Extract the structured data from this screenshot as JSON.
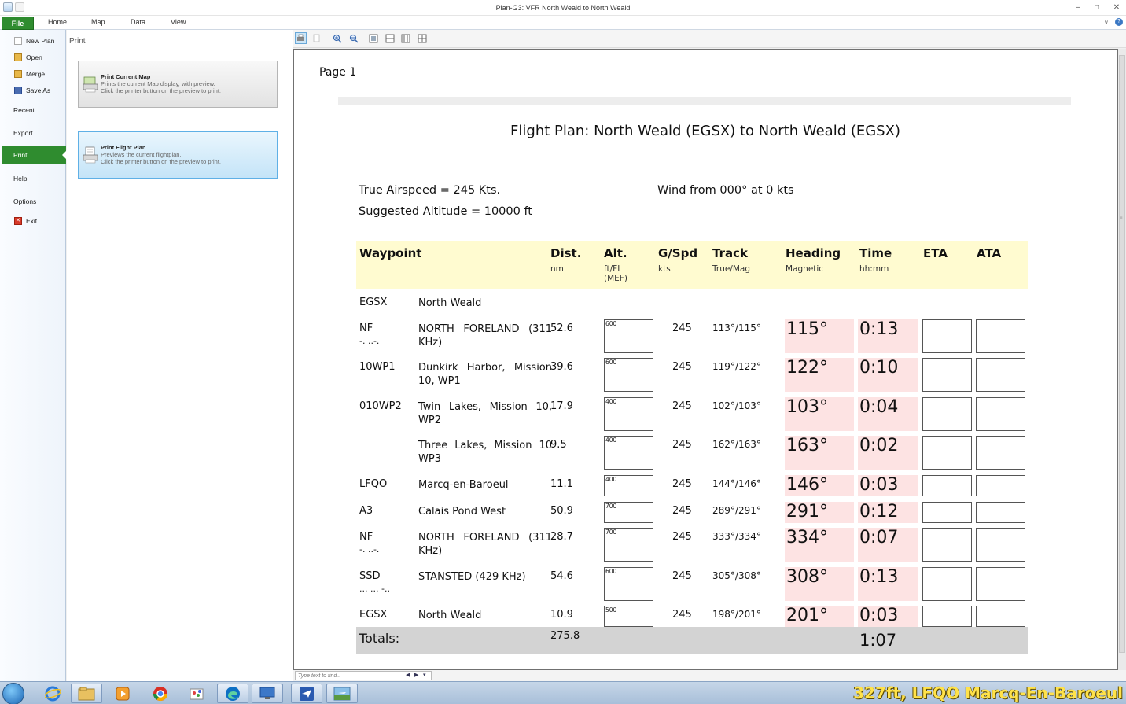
{
  "window": {
    "title": "Plan-G3: VFR North Weald to North Weald"
  },
  "ribbon": {
    "tabs": [
      "File",
      "Home",
      "Map",
      "Data",
      "View"
    ]
  },
  "leftnav": {
    "items": [
      {
        "label": "New Plan",
        "icon": "new-plan-icon"
      },
      {
        "label": "Open",
        "icon": "folder-open-icon"
      },
      {
        "label": "Merge",
        "icon": "merge-icon"
      },
      {
        "label": "Save As",
        "icon": "save-icon"
      },
      {
        "label": "Recent"
      },
      {
        "label": "Export"
      },
      {
        "label": "Print",
        "active": true
      },
      {
        "label": "Help"
      },
      {
        "label": "Options"
      },
      {
        "label": "Exit",
        "icon": "exit-icon"
      }
    ]
  },
  "print_panel": {
    "title": "Print",
    "options": [
      {
        "title": "Print Current Map",
        "line1": "Prints the current Map display, with preview.",
        "line2": "Click the printer button on the preview to print.",
        "selected": false
      },
      {
        "title": "Print Flight Plan",
        "line1": "Previews the current flightplan.",
        "line2": "Click the printer button on the preview to print.",
        "selected": true
      }
    ]
  },
  "preview": {
    "page_label": "Page 1",
    "title": "Flight Plan: North Weald (EGSX) to North Weald (EGSX)",
    "true_airspeed": "True Airspeed = 245 Kts.",
    "wind": "Wind from 000° at 0 kts",
    "suggested_altitude": "Suggested Altitude = 10000 ft",
    "headers": {
      "waypoint": "Waypoint",
      "dist": "Dist.",
      "dist_sub": "nm",
      "alt": "Alt.",
      "alt_sub1": "ft/FL",
      "alt_sub2": "(MEF)",
      "gspd": "G/Spd",
      "gspd_sub": "kts",
      "track": "Track",
      "track_sub": "True/Mag",
      "heading": "Heading",
      "heading_sub": "Magnetic",
      "time": "Time",
      "time_sub": "hh:mm",
      "eta": "ETA",
      "ata": "ATA"
    },
    "rows": [
      {
        "id": "EGSX",
        "morse": "",
        "name": "North Weald",
        "dist": "",
        "alt": "",
        "gs": "",
        "track": "",
        "heading": "",
        "time": ""
      },
      {
        "id": "NF",
        "morse": "-. ..-.",
        "name": "NORTH FORELAND (311 KHz)",
        "dist": "52.6",
        "alt": "600",
        "gs": "245",
        "track": "113°/115°",
        "heading": "115°",
        "time": "0:13"
      },
      {
        "id": "10WP1",
        "morse": "",
        "name": "Dunkirk Harbor, Mission 10, WP1",
        "dist": "39.6",
        "alt": "600",
        "gs": "245",
        "track": "119°/122°",
        "heading": "122°",
        "time": "0:10"
      },
      {
        "id": "010WP2",
        "morse": "",
        "name": "Twin Lakes, Mission 10, WP2",
        "dist": "17.9",
        "alt": "400",
        "gs": "245",
        "track": "102°/103°",
        "heading": "103°",
        "time": "0:04"
      },
      {
        "id": "",
        "morse": "",
        "name": "Three Lakes, Mission 10 WP3",
        "dist": "9.5",
        "alt": "400",
        "gs": "245",
        "track": "162°/163°",
        "heading": "163°",
        "time": "0:02"
      },
      {
        "id": "LFQO",
        "morse": "",
        "name": "Marcq-en-Baroeul",
        "dist": "11.1",
        "alt": "400",
        "gs": "245",
        "track": "144°/146°",
        "heading": "146°",
        "time": "0:03"
      },
      {
        "id": "A3",
        "morse": "",
        "name": "Calais Pond West",
        "dist": "50.9",
        "alt": "700",
        "gs": "245",
        "track": "289°/291°",
        "heading": "291°",
        "time": "0:12"
      },
      {
        "id": "NF",
        "morse": "-. ..-.",
        "name": "NORTH FORELAND (311 KHz)",
        "dist": "28.7",
        "alt": "700",
        "gs": "245",
        "track": "333°/334°",
        "heading": "334°",
        "time": "0:07"
      },
      {
        "id": "SSD",
        "morse": "... ... -..",
        "name": "STANSTED (429 KHz)",
        "dist": "54.6",
        "alt": "600",
        "gs": "245",
        "track": "305°/308°",
        "heading": "308°",
        "time": "0:13"
      },
      {
        "id": "EGSX",
        "morse": "",
        "name": "North Weald",
        "dist": "10.9",
        "alt": "500",
        "gs": "245",
        "track": "198°/201°",
        "heading": "201°",
        "time": "0:03"
      }
    ],
    "totals": {
      "label": "Totals:",
      "dist": "275.8",
      "time": "1:07"
    }
  },
  "find": {
    "placeholder": "Type text to find.."
  },
  "taskbar": {
    "apps": [
      "ie-icon",
      "explorer-icon",
      "media-player-icon",
      "chrome-icon",
      "paint-icon",
      "edge-icon",
      "remote-desktop-icon",
      "plan-g-icon",
      "flight-sim-icon"
    ],
    "overlay_text": "327ft, LFQO Marcq-En-Baroeul"
  },
  "colors": {
    "file_green": "#2f8c2f",
    "header_yellow": "#fffbd0",
    "cell_pink": "#fde3e3",
    "totals_gray": "#d3d3d3",
    "overlay_yellow": "#ffe24a"
  }
}
